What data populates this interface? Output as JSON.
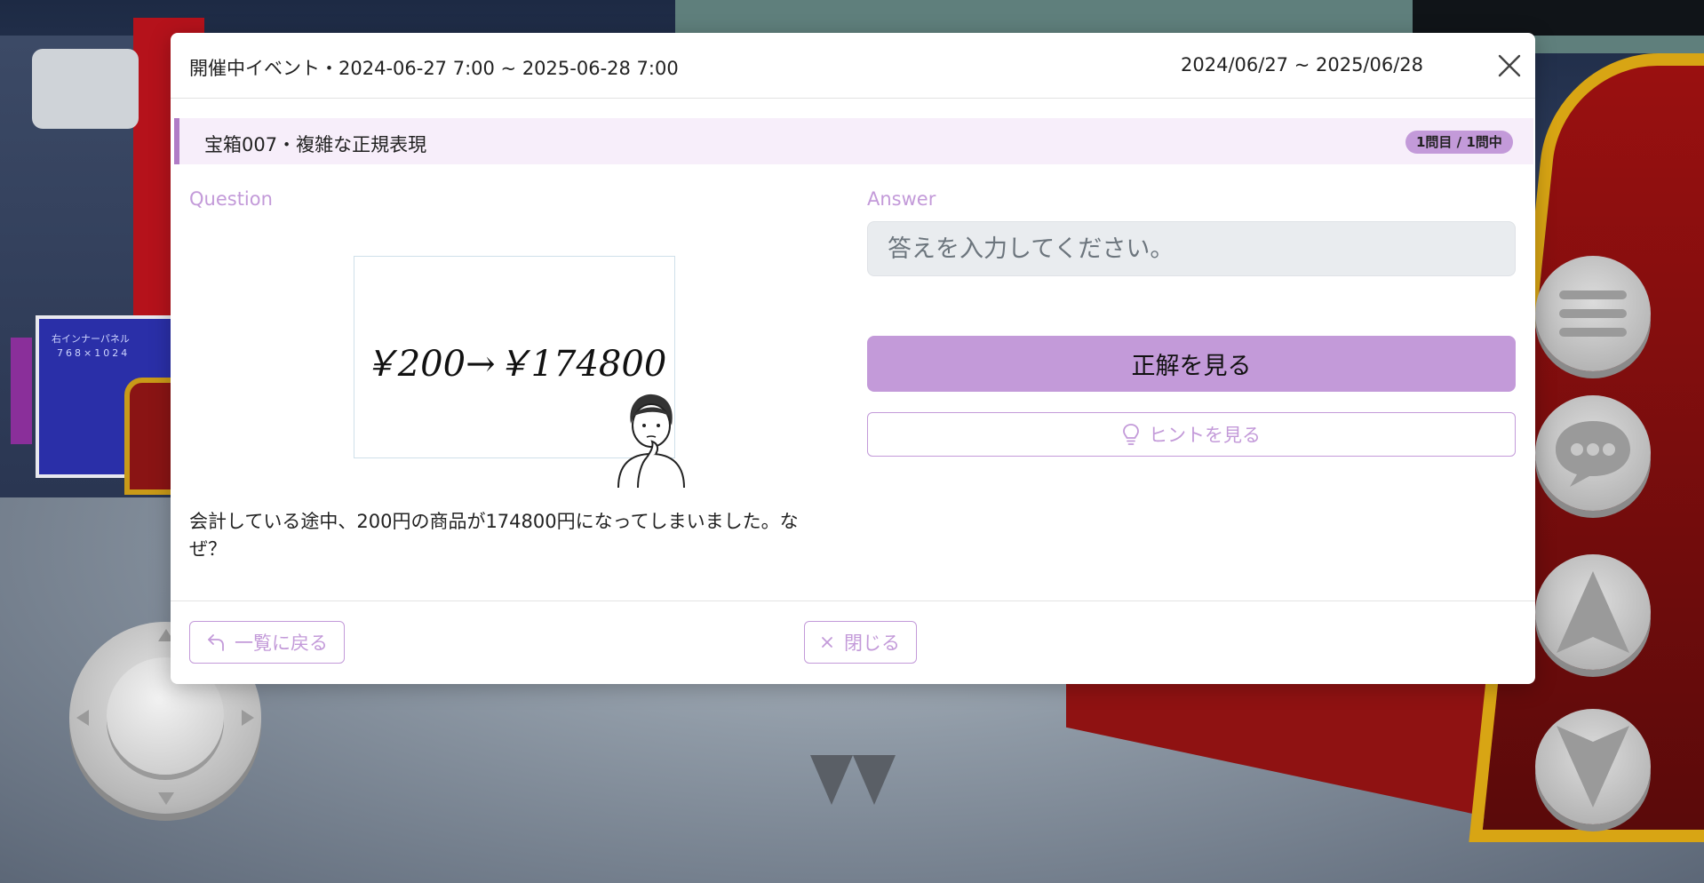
{
  "header": {
    "event_label": "開催中イベント・2024-06-27 7:00 ~ 2025-06-28 7:00",
    "date_range": "2024/06/27 ~ 2025/06/28",
    "close_icon": "close-icon"
  },
  "quiz": {
    "title": "宝箱007・複雑な正規表現",
    "progress_badge": "1問目 / 1問中"
  },
  "question": {
    "label": "Question",
    "image_text": "￥200→￥174800",
    "text": "会計している途中、200円の商品が174800円になってしまいました。なぜ？"
  },
  "answer": {
    "label": "Answer",
    "placeholder": "答えを入力してください。",
    "value": "",
    "show_answer_label": "正解を見る",
    "hint_label": "ヒントを見る",
    "hint_icon": "lightbulb-icon"
  },
  "footer": {
    "back_label": "一覧に戻る",
    "back_icon": "return-arrow-icon",
    "close_label": "閉じる",
    "close_icon": "x-icon"
  },
  "background": {
    "panel_text_1": "右インナーパネル",
    "panel_text_2": "768×1024"
  },
  "colors": {
    "accent": "#c39ad9",
    "subheader_bg": "#f7eefa",
    "subheader_border": "#b07cc6",
    "input_bg": "#e9ecef"
  }
}
